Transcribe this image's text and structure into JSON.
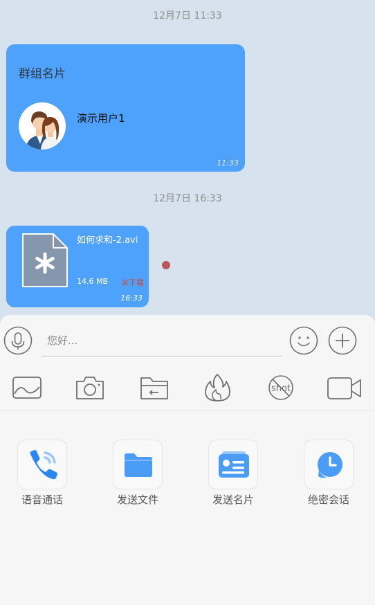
{
  "chat": {
    "timestamp_1": "12月7日 11:33",
    "card_message": {
      "title": "群组名片",
      "name": "演示用户1",
      "time": "11:33"
    },
    "timestamp_2": "12月7日 16:33",
    "file_message": {
      "file_name": "如何求和-2.avi",
      "file_size": "14.6 MB",
      "status": "未下载",
      "time": "16:33"
    }
  },
  "composer": {
    "placeholder": "您好...",
    "icons": [
      "microphone-icon",
      "emoji-icon",
      "plus-icon"
    ]
  },
  "toolbar": {
    "icons": [
      "image-icon",
      "camera-icon",
      "folder-icon",
      "flame-icon",
      "screenshot-icon",
      "video-icon"
    ],
    "shot_label": "shot"
  },
  "actions": [
    {
      "label": "语音通话",
      "icon": "phone-icon"
    },
    {
      "label": "发送文件",
      "icon": "folder-icon"
    },
    {
      "label": "发送名片",
      "icon": "card-icon"
    },
    {
      "label": "绝密会话",
      "icon": "clock-icon"
    }
  ],
  "colors": {
    "bubble": "#4ea2fb",
    "chat_background": "#d6e3ef",
    "panel_background": "#f6f6f6",
    "icon_accent": "#4b9cf5"
  }
}
